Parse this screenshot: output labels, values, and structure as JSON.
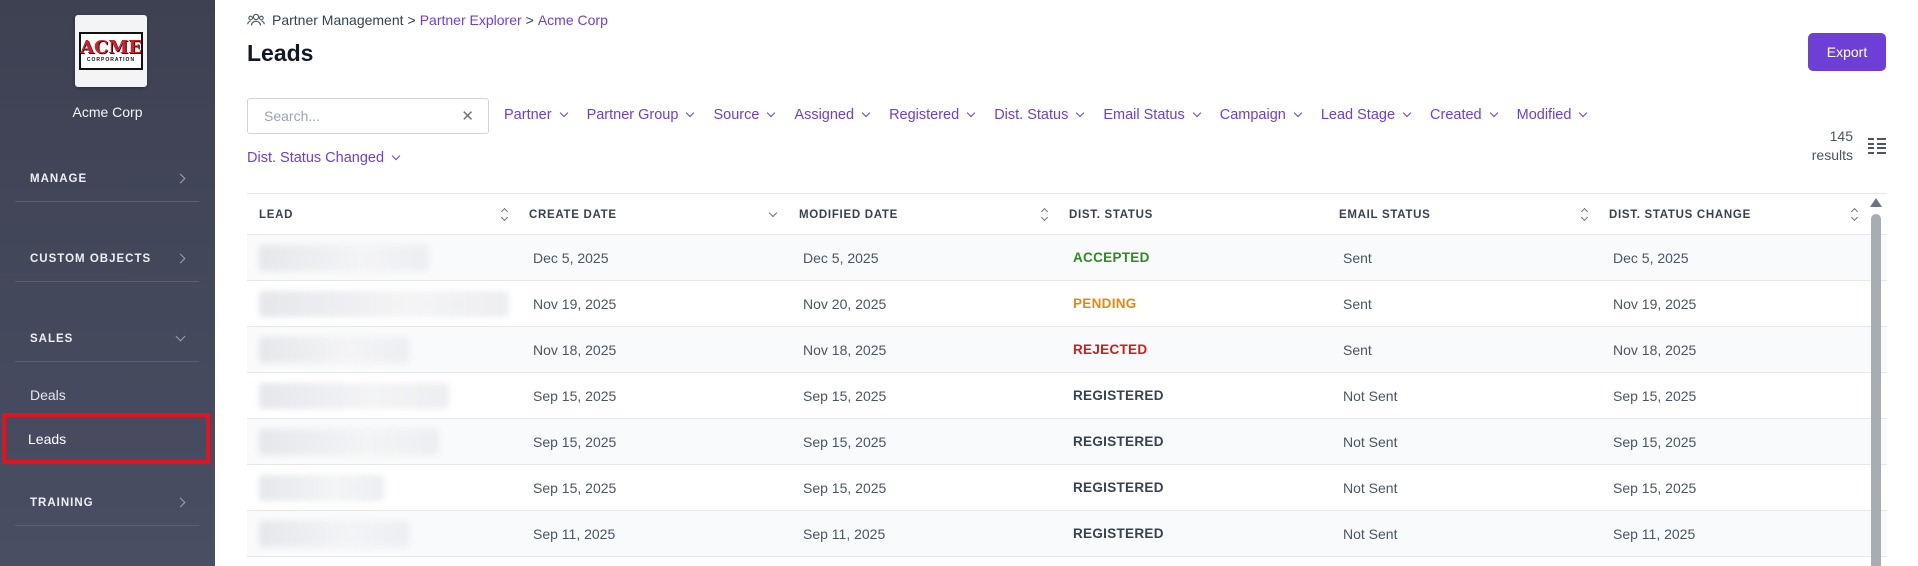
{
  "brand": {
    "logo_text": "ACME",
    "logo_sub": "CORPORATION",
    "name": "Acme Corp"
  },
  "sidebar": {
    "sections": [
      {
        "label": "MANAGE",
        "state": "collapsed"
      },
      {
        "label": "CUSTOM OBJECTS",
        "state": "collapsed"
      },
      {
        "label": "SALES",
        "state": "expanded"
      },
      {
        "label": "TRAINING",
        "state": "collapsed"
      }
    ],
    "sales_items": [
      {
        "label": "Deals"
      },
      {
        "label": "Leads",
        "active": true
      }
    ]
  },
  "breadcrumb": {
    "root": "Partner Management",
    "sep": ">",
    "level2": "Partner Explorer",
    "level3": "Acme Corp"
  },
  "page": {
    "title": "Leads",
    "export_label": "Export"
  },
  "search": {
    "placeholder": "Search...",
    "value": "",
    "clear": "✕"
  },
  "filters": [
    "Partner",
    "Partner Group",
    "Source",
    "Assigned",
    "Registered",
    "Dist. Status",
    "Email Status",
    "Campaign",
    "Lead Stage",
    "Created",
    "Modified"
  ],
  "filters_row2": [
    "Dist. Status Changed"
  ],
  "results": {
    "count": "145",
    "label": "results"
  },
  "table": {
    "columns": [
      "LEAD",
      "CREATE DATE",
      "MODIFIED DATE",
      "DIST. STATUS",
      "EMAIL STATUS",
      "DIST. STATUS CHANGE"
    ],
    "rows": [
      {
        "lead": "",
        "create": "Dec 5, 2025",
        "modified": "Dec 5, 2025",
        "status": "ACCEPTED",
        "email": "Sent",
        "changed": "Dec 5, 2025"
      },
      {
        "lead": "",
        "create": "Nov 19, 2025",
        "modified": "Nov 20, 2025",
        "status": "PENDING",
        "email": "Sent",
        "changed": "Nov 19, 2025"
      },
      {
        "lead": "",
        "create": "Nov 18, 2025",
        "modified": "Nov 18, 2025",
        "status": "REJECTED",
        "email": "Sent",
        "changed": "Nov 18, 2025"
      },
      {
        "lead": "",
        "create": "Sep 15, 2025",
        "modified": "Sep 15, 2025",
        "status": "REGISTERED",
        "email": "Not Sent",
        "changed": "Sep 15, 2025"
      },
      {
        "lead": "",
        "create": "Sep 15, 2025",
        "modified": "Sep 15, 2025",
        "status": "REGISTERED",
        "email": "Not Sent",
        "changed": "Sep 15, 2025"
      },
      {
        "lead": "",
        "create": "Sep 15, 2025",
        "modified": "Sep 15, 2025",
        "status": "REGISTERED",
        "email": "Not Sent",
        "changed": "Sep 15, 2025"
      },
      {
        "lead": "",
        "create": "Sep 11, 2025",
        "modified": "Sep 11, 2025",
        "status": "REGISTERED",
        "email": "Not Sent",
        "changed": "Sep 11, 2025"
      }
    ]
  },
  "colors": {
    "accent": "#6d3fd6",
    "status_accepted": "#2e8b1f",
    "status_pending": "#e08a12",
    "status_rejected": "#cc1f1a",
    "status_registered": "#374151",
    "highlight": "#e0141e"
  },
  "icons": {
    "breadcrumb": "people-icon",
    "view_toggle": "list-view-icon"
  }
}
